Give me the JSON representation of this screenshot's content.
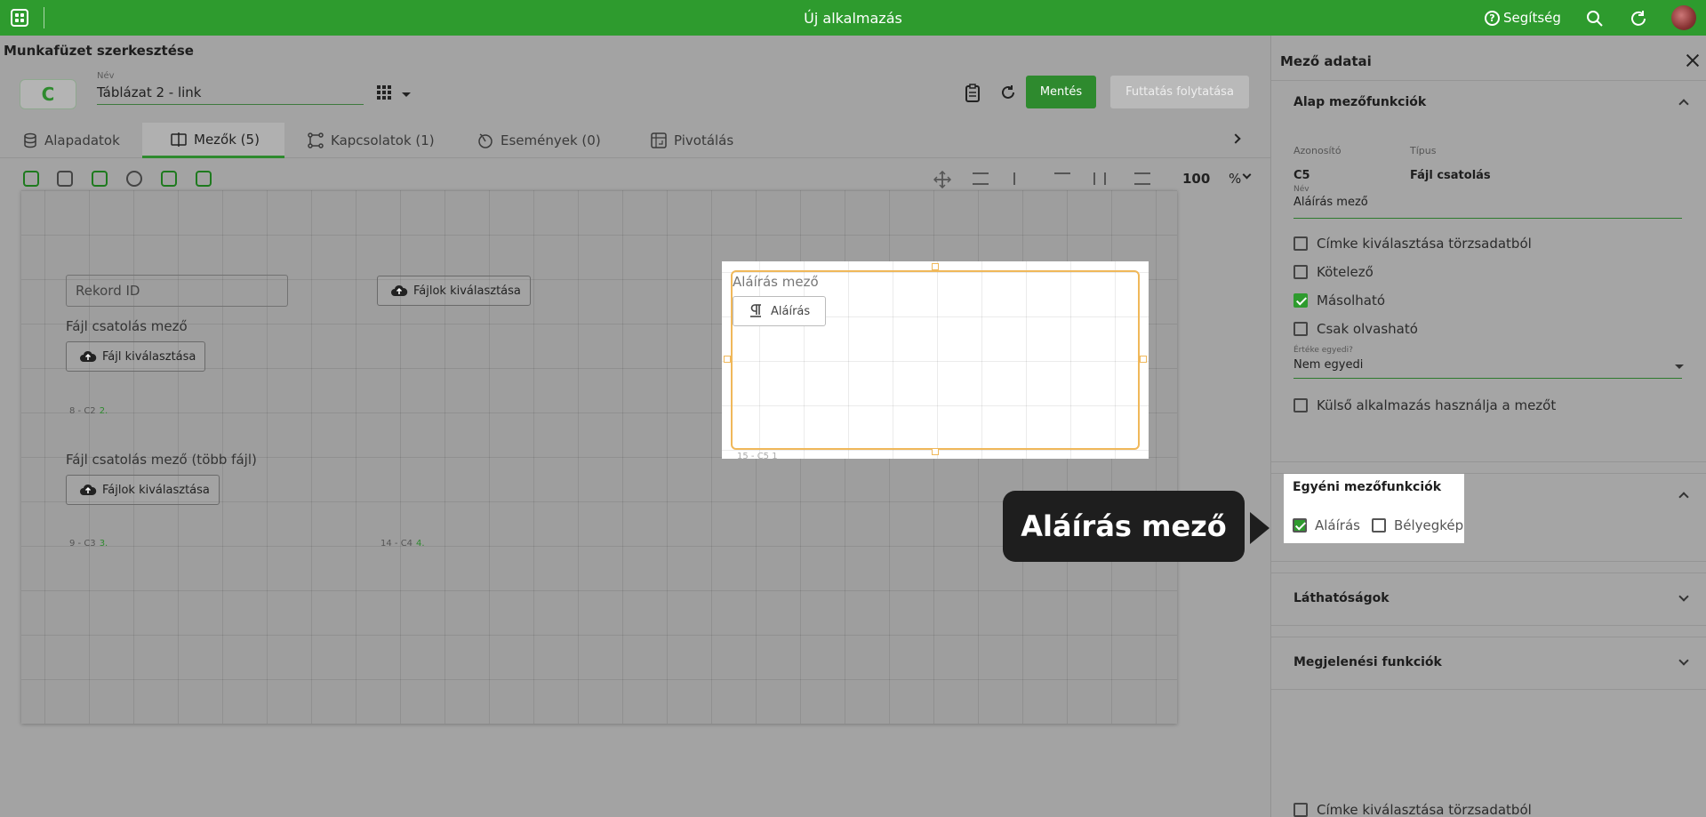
{
  "topbar": {
    "app_title": "Új alkalmazás",
    "help_label": "Segítség"
  },
  "editor": {
    "page_title": "Munkafüzet szerkesztése",
    "badge": "C",
    "name_label": "Név",
    "name_value": "Táblázat 2 - link",
    "save_label": "Mentés",
    "continue_label": "Futtatás folytatása"
  },
  "tabs": [
    {
      "label": "Alapadatok",
      "icon": "database-icon"
    },
    {
      "label": "Mezők (5)",
      "icon": "fields-icon"
    },
    {
      "label": "Kapcsolatok (1)",
      "icon": "relations-icon"
    },
    {
      "label": "Események (0)",
      "icon": "events-icon"
    },
    {
      "label": "Pivotálás",
      "icon": "pivot-icon"
    }
  ],
  "zoom": {
    "value": "100",
    "unit": "%"
  },
  "canvas": {
    "record_id_placeholder": "Rekord ID",
    "upload_files_label": "Fájlok kiválasztása",
    "upload_file_label": "Fájl kiválasztása",
    "file_field_label": "Fájl csatolás mező",
    "file_field_id": "8 - C2",
    "file_field_seq": "2.",
    "multi_file_label": "Fájl csatolás mező (több fájl)",
    "multi_file_id": "9 - C3",
    "multi_file_seq": "3.",
    "top_upload_id": "14 - C4",
    "top_upload_seq": "4.",
    "sig_label": "Aláírás mező",
    "sig_button": "Aláírás",
    "sig_id": "15 - C5",
    "sig_seq": "1"
  },
  "tooltip": "Aláírás mező",
  "panel": {
    "title": "Mező adatai",
    "basic_section": "Alap mezőfunkciók",
    "id_label": "Azonosító",
    "id_value": "C5",
    "type_label": "Típus",
    "type_value": "Fájl csatolás",
    "name_label": "Név",
    "name_value": "Aláírás mező",
    "checks": [
      {
        "label": "Címke kiválasztása törzsadatból",
        "checked": false
      },
      {
        "label": "Kötelező",
        "checked": false
      },
      {
        "label": "Másolható",
        "checked": true
      },
      {
        "label": "Csak olvasható",
        "checked": false
      }
    ],
    "unique_label": "Értéke egyedi?",
    "unique_value": "Nem egyedi",
    "external_label": "Külső alkalmazás használja a mezőt",
    "custom_section": "Egyéni mezőfunkciók",
    "custom_sig": "Aláírás",
    "custom_stamp": "Bélyegkép",
    "visibility_section": "Láthatóságok",
    "display_section": "Megjelenési funkciók",
    "bottom_check": "Címke kiválasztása törzsadatból"
  },
  "colors": {
    "brand_green": "#2e9b2e",
    "selection_orange": "#f0b85a",
    "tooltip_bg": "#1e1e1e"
  }
}
